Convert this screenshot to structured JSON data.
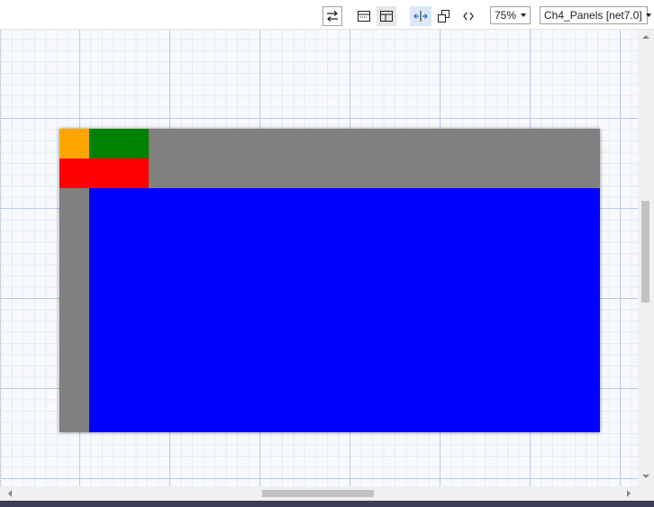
{
  "toolbar": {
    "icons": [
      "swap-icon",
      "horizontal-split-icon",
      "vertical-split-icon",
      "fit-width-icon",
      "copy-icon",
      "xaml-code-icon"
    ],
    "zoom_value": "75%",
    "project_value": "Ch4_Panels [net7.0]"
  },
  "artboard": {
    "panels": [
      {
        "name": "top-bar-panel",
        "color": "#808080"
      },
      {
        "name": "left-bar-panel",
        "color": "#808080"
      },
      {
        "name": "orange-panel",
        "color": "#FFA500"
      },
      {
        "name": "green-panel",
        "color": "#008000"
      },
      {
        "name": "red-panel",
        "color": "#FF0000"
      },
      {
        "name": "blue-panel",
        "color": "#0000FF"
      }
    ]
  },
  "scrollbars": {
    "vertical": {
      "position": 0.55
    },
    "horizontal": {
      "position": 0.41
    }
  }
}
